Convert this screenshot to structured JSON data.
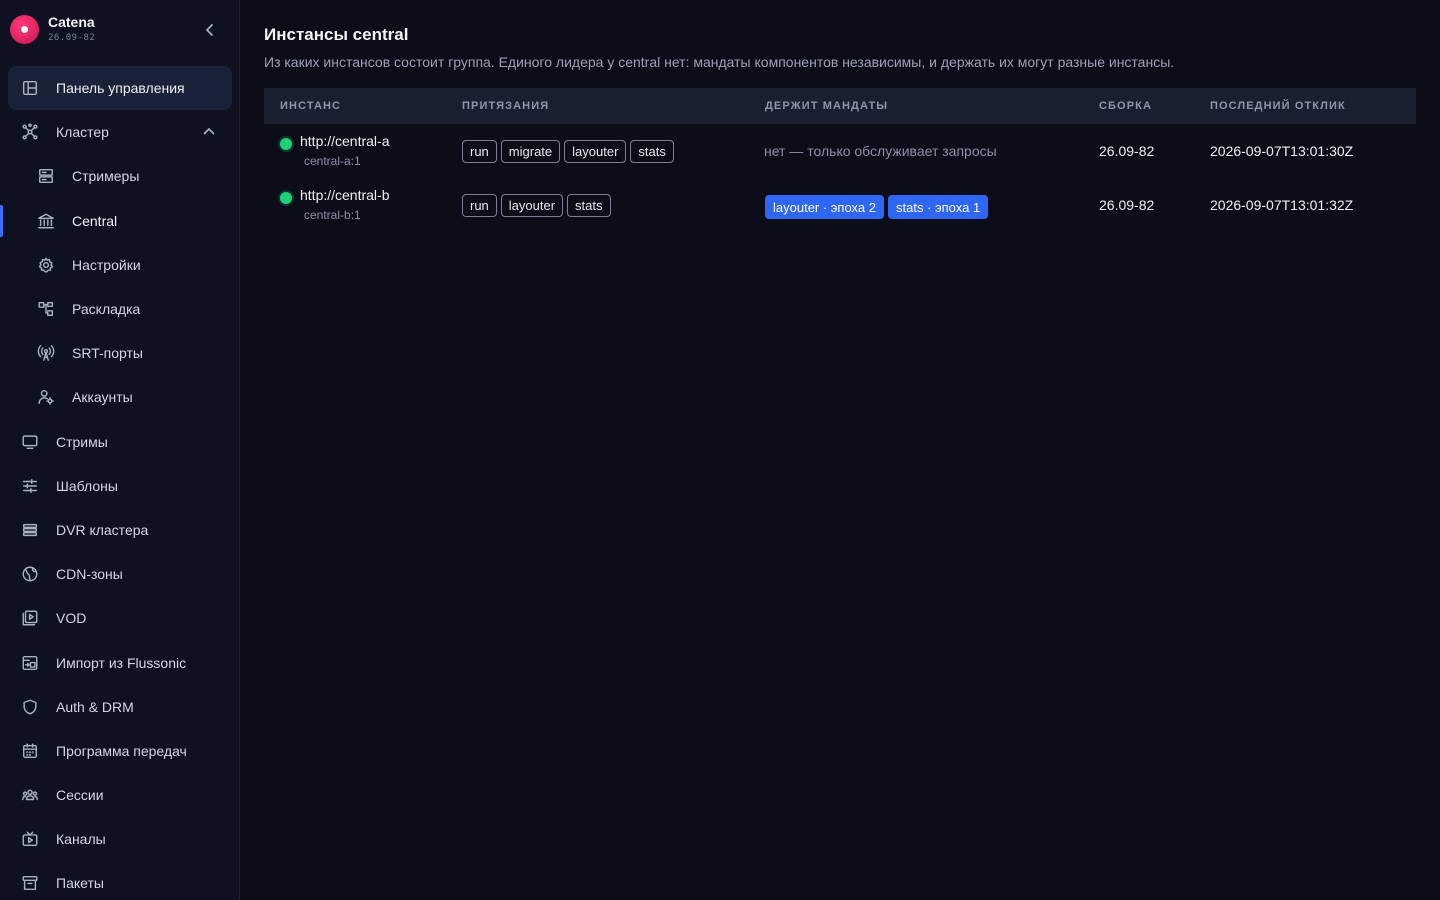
{
  "app": {
    "name": "Catena",
    "version": "26.09-82"
  },
  "sidebar": {
    "items": [
      {
        "label": "Панель управления",
        "icon": "dashboard-icon",
        "level": 0,
        "state": "active-main"
      },
      {
        "label": "Кластер",
        "icon": "cluster-icon",
        "level": 0,
        "expanded": true
      },
      {
        "label": "Стримеры",
        "icon": "server-icon",
        "level": 1
      },
      {
        "label": "Central",
        "icon": "bank-icon",
        "level": 1,
        "state": "current"
      },
      {
        "label": "Настройки",
        "icon": "gear-icon",
        "level": 1
      },
      {
        "label": "Раскладка",
        "icon": "layout-icon",
        "level": 1
      },
      {
        "label": "SRT-порты",
        "icon": "antenna-icon",
        "level": 1
      },
      {
        "label": "Аккаунты",
        "icon": "user-gear-icon",
        "level": 1
      },
      {
        "label": "Стримы",
        "icon": "monitor-icon",
        "level": 0
      },
      {
        "label": "Шаблоны",
        "icon": "sliders-icon",
        "level": 0
      },
      {
        "label": "DVR кластера",
        "icon": "list-icon",
        "level": 0
      },
      {
        "label": "CDN-зоны",
        "icon": "globe-icon",
        "level": 0
      },
      {
        "label": "VOD",
        "icon": "video-library-icon",
        "level": 0
      },
      {
        "label": "Импорт из Flussonic",
        "icon": "import-icon",
        "level": 0
      },
      {
        "label": "Auth & DRM",
        "icon": "shield-icon",
        "level": 0
      },
      {
        "label": "Программа передач",
        "icon": "calendar-icon",
        "level": 0
      },
      {
        "label": "Сессии",
        "icon": "users-icon",
        "level": 0
      },
      {
        "label": "Каналы",
        "icon": "tv-icon",
        "level": 0
      },
      {
        "label": "Пакеты",
        "icon": "archive-icon",
        "level": 0
      }
    ]
  },
  "main": {
    "title": "Инстансы central",
    "subtitle": "Из каких инстансов состоит группа. Единого лидера у central нет: мандаты компонентов независимы, и держать их могут разные инстансы.",
    "columns": [
      "ИНСТАНС",
      "ПРИТЯЗАНИЯ",
      "ДЕРЖИТ МАНДАТЫ",
      "СБОРКА",
      "ПОСЛЕДНИЙ ОТКЛИК"
    ],
    "rows": [
      {
        "url": "http://central-a",
        "id": "central-a:1",
        "status_color": "#1fd07a",
        "claims": [
          "run",
          "migrate",
          "layouter",
          "stats"
        ],
        "mandates_text": "нет — только обслуживает запросы",
        "mandates": [],
        "build": "26.09-82",
        "last_seen": "2026-09-07T13:01:30Z"
      },
      {
        "url": "http://central-b",
        "id": "central-b:1",
        "status_color": "#1fd07a",
        "claims": [
          "run",
          "layouter",
          "stats"
        ],
        "mandates_text": "",
        "mandates": [
          "layouter · эпоха 2",
          "stats · эпоха 1"
        ],
        "build": "26.09-82",
        "last_seen": "2026-09-07T13:01:32Z"
      }
    ]
  },
  "colors": {
    "accent": "#3f6cf4",
    "mandate": "#2f66f5",
    "online": "#1fd07a",
    "brand": "#e8215f"
  }
}
